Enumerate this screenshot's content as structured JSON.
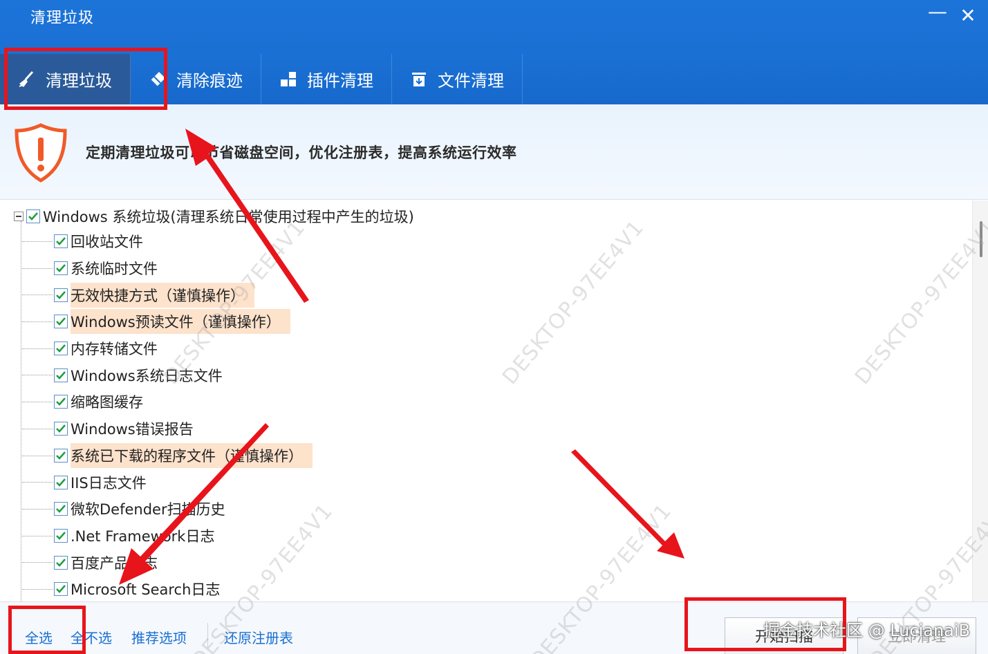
{
  "window": {
    "title": "清理垃圾",
    "minimize_glyph": "—",
    "close_glyph": "✕"
  },
  "tabs": [
    {
      "label": "清理垃圾",
      "icon": "broom-icon",
      "active": true
    },
    {
      "label": "清除痕迹",
      "icon": "eraser-icon",
      "active": false
    },
    {
      "label": "插件清理",
      "icon": "puzzle-icon",
      "active": false
    },
    {
      "label": "文件清理",
      "icon": "trash-bin-icon",
      "active": false
    }
  ],
  "info": {
    "icon": "warning-shield-icon",
    "text": "定期清理垃圾可以节省磁盘空间，优化注册表，提高系统运行效率"
  },
  "tree": {
    "root_label": "Windows 系统垃圾(清理系统日常使用过程中产生的垃圾)",
    "items": [
      {
        "label": "回收站文件",
        "checked": true,
        "warning": false
      },
      {
        "label": "系统临时文件",
        "checked": true,
        "warning": false
      },
      {
        "label": "无效快捷方式（谨慎操作）",
        "checked": true,
        "warning": true
      },
      {
        "label": "Windows预读文件（谨慎操作）",
        "checked": true,
        "warning": true
      },
      {
        "label": "内存转储文件",
        "checked": true,
        "warning": false
      },
      {
        "label": "Windows系统日志文件",
        "checked": true,
        "warning": false
      },
      {
        "label": "缩略图缓存",
        "checked": true,
        "warning": false
      },
      {
        "label": "Windows错误报告",
        "checked": true,
        "warning": false
      },
      {
        "label": "系统已下载的程序文件（谨慎操作）",
        "checked": true,
        "warning": true
      },
      {
        "label": "IIS日志文件",
        "checked": true,
        "warning": false
      },
      {
        "label": "微软Defender扫描历史",
        "checked": true,
        "warning": false
      },
      {
        "label": ".Net Framework日志",
        "checked": true,
        "warning": false
      },
      {
        "label": "百度产品日志",
        "checked": true,
        "warning": false
      },
      {
        "label": "Microsoft Search日志",
        "checked": true,
        "warning": false
      }
    ]
  },
  "footer": {
    "select_all": "全选",
    "select_none": "全不选",
    "recommended": "推荐选项",
    "restore_registry": "还原注册表",
    "scan_button": "开始扫描",
    "clean_button": "立即清理"
  },
  "overlay": {
    "credit": "掘金技术社区 @ LucianaiB",
    "watermark": "DESKTOP-97EE4V1",
    "highlight_color": "#e8141b"
  }
}
